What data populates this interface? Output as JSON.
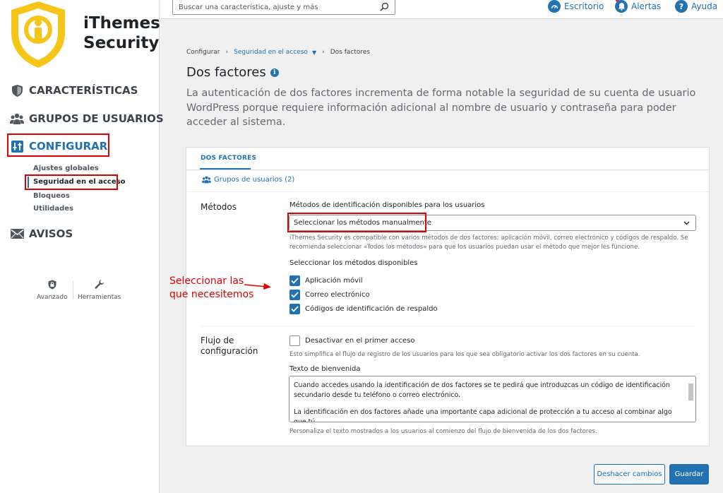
{
  "app": {
    "brand_line1": "iThemes",
    "brand_line2": "Security"
  },
  "sidebar": {
    "nav": [
      {
        "label": "CARACTERÍSTICAS",
        "icon": "shield-icon"
      },
      {
        "label": "GRUPOS DE USUARIOS",
        "icon": "users-icon"
      },
      {
        "label": "CONFIGURAR",
        "icon": "sliders-icon"
      },
      {
        "label": "AVISOS",
        "icon": "envelope-icon"
      }
    ],
    "subitems": [
      "Ajustes globales",
      "Seguridad en el acceso",
      "Bloqueos",
      "Utilidades"
    ],
    "footer": [
      {
        "label": "Avanzado",
        "icon": "lock-shield-icon"
      },
      {
        "label": "Herramientas",
        "icon": "wrench-icon"
      }
    ]
  },
  "topbar": {
    "search_placeholder": "Buscar una característica, ajuste y más",
    "links": [
      {
        "label": "Escritorio",
        "icon": "dashboard-icon"
      },
      {
        "label": "Alertas",
        "icon": "bell-icon"
      },
      {
        "label": "Ayuda",
        "icon": "help-icon"
      }
    ]
  },
  "breadcrumb": {
    "root": "Configurar",
    "middle": "Seguridad en el acceso",
    "current": "Dos factores"
  },
  "page": {
    "title": "Dos factores",
    "description": "La autenticación de dos factores incrementa de forma notable la seguridad de su cuenta de usuario WordPress porque requiere información adicional al nombre de usuario y contraseña para poder acceder al sistema."
  },
  "card": {
    "tab": "DOS FACTORES",
    "groups_link": "Grupos de usuarios (2)",
    "methods": {
      "section": "Métodos",
      "field_label": "Métodos de identificación disponibles para los usuarios",
      "select_value": "Seleccionar los métodos manualmente",
      "help": "iThemes Security es compatible con varios métodos de dos factores: aplicación móvil, correo electrónico y códigos de respaldo. Se recomienda seleccionar «Todos los métodos» para que los usuarios puedan usar el método que mejor les funcione.",
      "available_label": "Seleccionar los métodos disponibles",
      "options": [
        {
          "label": "Aplicación móvil",
          "checked": true
        },
        {
          "label": "Correo electrónico",
          "checked": true
        },
        {
          "label": "Códigos de identificación de respaldo",
          "checked": true
        }
      ]
    },
    "flow": {
      "section": "Flujo de configuración",
      "checkbox_label": "Desactivar en el primer acceso",
      "checkbox_checked": false,
      "help": "Esto simplifica el flujo de registro de los usuarios para los que sea obligatorio activar los dos factores en su cuenta.",
      "welcome_label": "Texto de bienvenida",
      "welcome_p1": "Cuando accedes usando la identificación de dos factores se te pedirá que introduzcas un código de identificación secundario desde tu teléfono o correo electrónico.",
      "welcome_p2": "La identificación en dos factores añade una importante capa adicional de protección a tu acceso al combinar algo que tú",
      "welcome_help": "Personaliza el texto mostrados a los usuarios al comienzo del flujo de bienvenida de los dos factores."
    }
  },
  "annotation": {
    "line1": "Seleccionar las",
    "line2": "que necesitemos"
  },
  "buttons": {
    "undo": "Deshacer cambios",
    "save": "Guardar"
  },
  "colors": {
    "accent": "#2271b1",
    "highlight": "#e00000",
    "brand_yellow": "#f5c518"
  }
}
